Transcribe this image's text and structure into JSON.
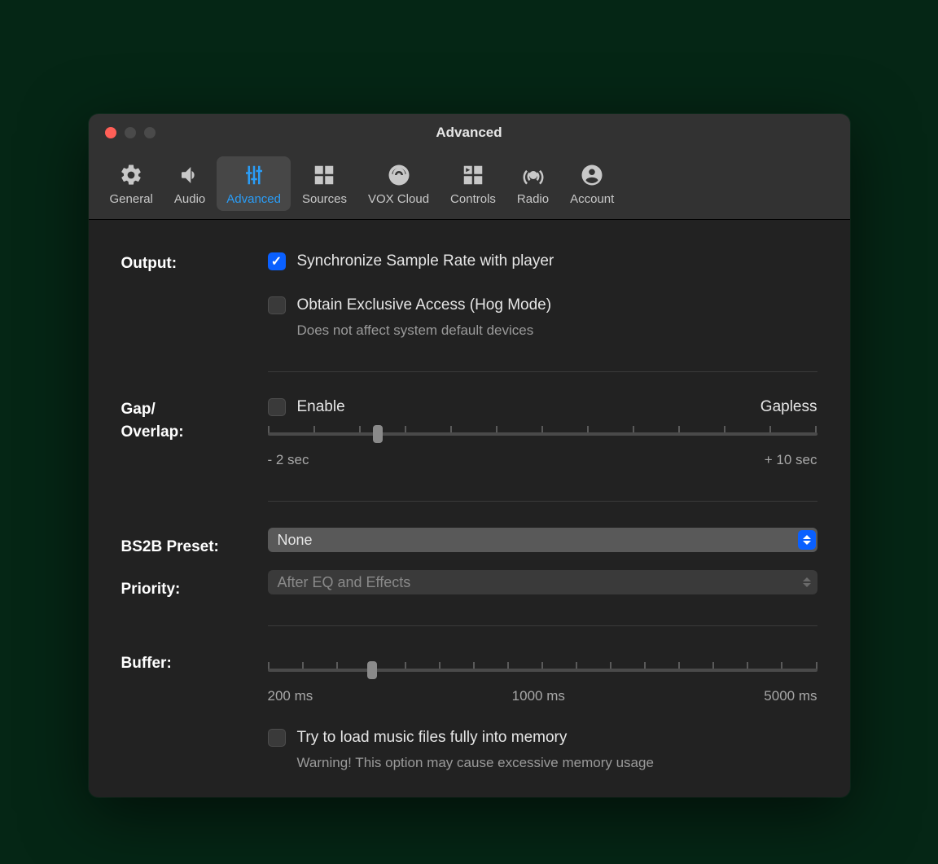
{
  "window": {
    "title": "Advanced"
  },
  "tabs": [
    {
      "label": "General"
    },
    {
      "label": "Audio"
    },
    {
      "label": "Advanced"
    },
    {
      "label": "Sources"
    },
    {
      "label": "VOX Cloud"
    },
    {
      "label": "Controls"
    },
    {
      "label": "Radio"
    },
    {
      "label": "Account"
    }
  ],
  "output": {
    "section_label": "Output:",
    "sync_label": "Synchronize Sample Rate with player",
    "sync_checked": true,
    "hog_label": "Obtain Exclusive Access (Hog Mode)",
    "hog_help": "Does not affect system default devices",
    "hog_checked": false
  },
  "gap": {
    "section_label": "Gap/\nOverlap:",
    "enable_label": "Enable",
    "enable_checked": false,
    "right_label": "Gapless",
    "min_label": "- 2 sec",
    "max_label": "+ 10 sec",
    "thumb_pct": 20
  },
  "bs2b": {
    "section_label": "BS2B Preset:",
    "value": "None",
    "priority_label": "Priority:",
    "priority_value": "After EQ and Effects"
  },
  "buffer": {
    "section_label": "Buffer:",
    "lo": "200 ms",
    "mid": "1000 ms",
    "hi": "5000 ms",
    "thumb_pct": 19,
    "load_label": "Try to load music files fully into memory",
    "load_help": "Warning! This option may cause excessive memory usage",
    "load_checked": false
  }
}
